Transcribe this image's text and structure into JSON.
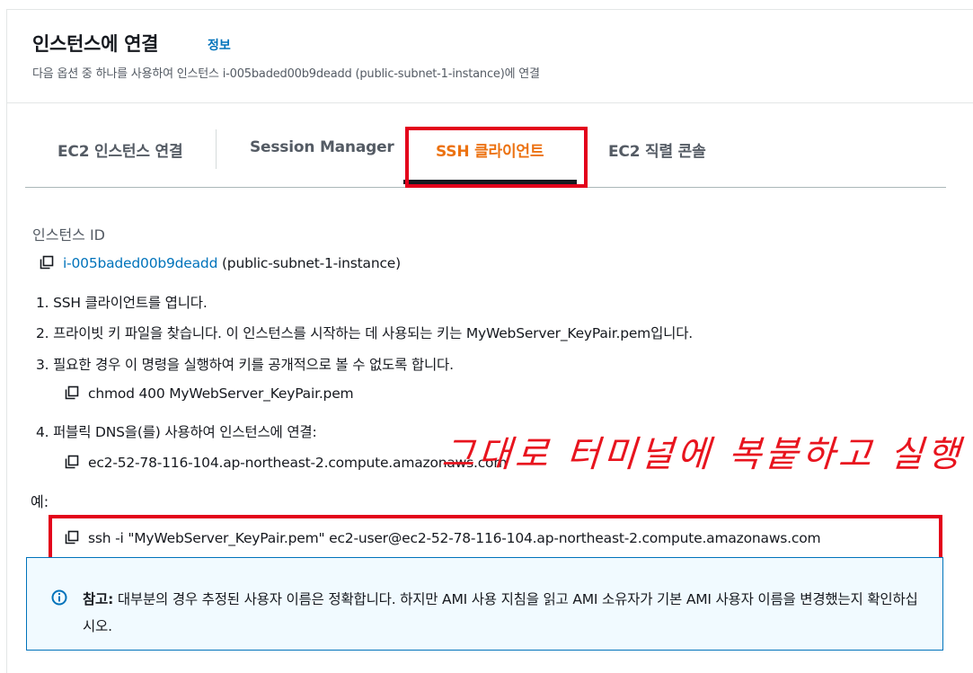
{
  "header": {
    "title": "인스턴스에 연결",
    "info_link": "정보",
    "subtitle": "다음 옵션 중 하나를 사용하여 인스턴스 i-005baded00b9deadd (public-subnet-1-instance)에 연결"
  },
  "tabs": [
    {
      "label": "EC2 인스턴스 연결",
      "active": false
    },
    {
      "label": "Session Manager",
      "active": false
    },
    {
      "label": "SSH 클라이언트",
      "active": true
    },
    {
      "label": "EC2 직렬 콘솔",
      "active": false
    }
  ],
  "instance": {
    "label": "인스턴스 ID",
    "id": "i-005baded00b9deadd",
    "name": "(public-subnet-1-instance)"
  },
  "steps": {
    "step1": "1. SSH 클라이언트를 엽니다.",
    "step2": "2. 프라이빗 키 파일을 찾습니다. 이 인스턴스를 시작하는 데 사용되는 키는 MyWebServer_KeyPair.pem입니다.",
    "step3": "3. 필요한 경우 이 명령을 실행하여 키를 공개적으로 볼 수 없도록 합니다.",
    "step3_cmd": "chmod 400 MyWebServer_KeyPair.pem",
    "step4": "4. 퍼블릭 DNS을(를) 사용하여 인스턴스에 연결:",
    "step4_dns": "ec2-52-78-116-104.ap-northeast-2.compute.amazonaws.com"
  },
  "example": {
    "label": "예:",
    "command": "ssh -i \"MyWebServer_KeyPair.pem\" ec2-user@ec2-52-78-116-104.ap-northeast-2.compute.amazonaws.com"
  },
  "annotation": "그대로 터미널에 복붙하고 실행",
  "note": {
    "prefix": "참고:",
    "text": "대부분의 경우 추정된 사용자 이름은 정확합니다. 하지만 AMI 사용 지침을 읽고 AMI 소유자가 기본 AMI 사용자 이름을 변경했는지 확인하십시오."
  },
  "colors": {
    "accent_orange": "#ec7211",
    "link_blue": "#0073bb",
    "annotation_red": "#e3001b",
    "info_bg": "#f1faff"
  },
  "icons": [
    "copy-icon",
    "info-icon"
  ]
}
